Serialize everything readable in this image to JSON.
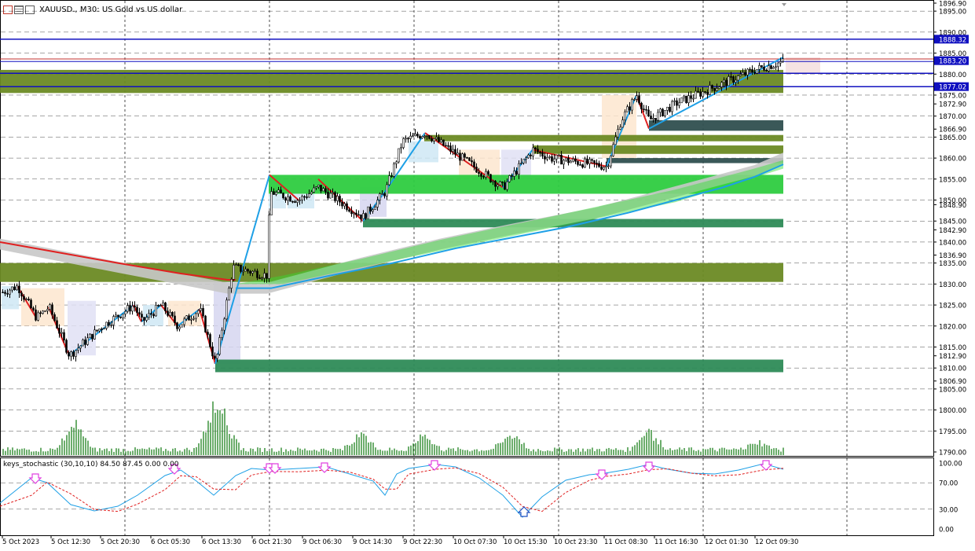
{
  "window": {
    "symbol": "XAUUSD.",
    "timeframe": "M30",
    "description": "US Gold vs US dollar",
    "title_text": "XAUUSD., M30:  US Gold vs US dollar"
  },
  "price_axis": {
    "ticks": [
      "1896.90",
      "1895.00",
      "1890.00",
      "1885.00",
      "1880.00",
      "1875.00",
      "1872.90",
      "1870.00",
      "1866.90",
      "1865.00",
      "1860.00",
      "1855.00",
      "1850.00",
      "1848.90",
      "1845.00",
      "1842.90",
      "1840.00",
      "1836.90",
      "1835.00",
      "1830.00",
      "1825.00",
      "1820.00",
      "1815.00",
      "1812.90",
      "1810.00",
      "1806.90",
      "1805.00",
      "1800.00",
      "1795.00",
      "1790.00"
    ],
    "highlighted": [
      {
        "label": "1888.32",
        "color": "#1010c0"
      },
      {
        "label": "1883.20",
        "color": "#1010c0"
      },
      {
        "label": "1877.02",
        "color": "#1010c0"
      }
    ]
  },
  "time_axis": {
    "labels": [
      "5 Oct 2023",
      "5 Oct 12:30",
      "5 Oct 20:30",
      "6 Oct 05:30",
      "6 Oct 13:30",
      "6 Oct 21:30",
      "9 Oct 06:30",
      "9 Oct 14:30",
      "9 Oct 22:30",
      "10 Oct 07:30",
      "10 Oct 15:30",
      "10 Oct 23:30",
      "11 Oct 08:30",
      "11 Oct 16:30",
      "12 Oct 01:30",
      "12 Oct 09:30"
    ]
  },
  "indicator": {
    "name": "keys_stochastic",
    "params": "(30,10,10)",
    "values": "84.50 87.45 0.00 0.00",
    "label_text": "keys_stochastic (30,10,10) 84.50 87.45 0.00 0.00",
    "axis_ticks": [
      "100.00",
      "70.00",
      "30.00",
      "0.00"
    ]
  },
  "colors": {
    "zone_olive": "#6b8a24",
    "zone_green": "#2ecc40",
    "zone_dark_green": "#2e8b57",
    "zone_dark_slate": "#2f4f4f",
    "level_blue": "#1010c0",
    "level_red": "#c03030",
    "ma_blue": "#1ea0e6",
    "ma_red": "#e02020",
    "ma_gray": "#c8c8c8",
    "volume": "#2d8a2d",
    "stoch_main": "#1ea0e6",
    "stoch_signal": "#e02020",
    "arrow_down": "#e040e0",
    "arrow_up": "#2050c0"
  }
}
